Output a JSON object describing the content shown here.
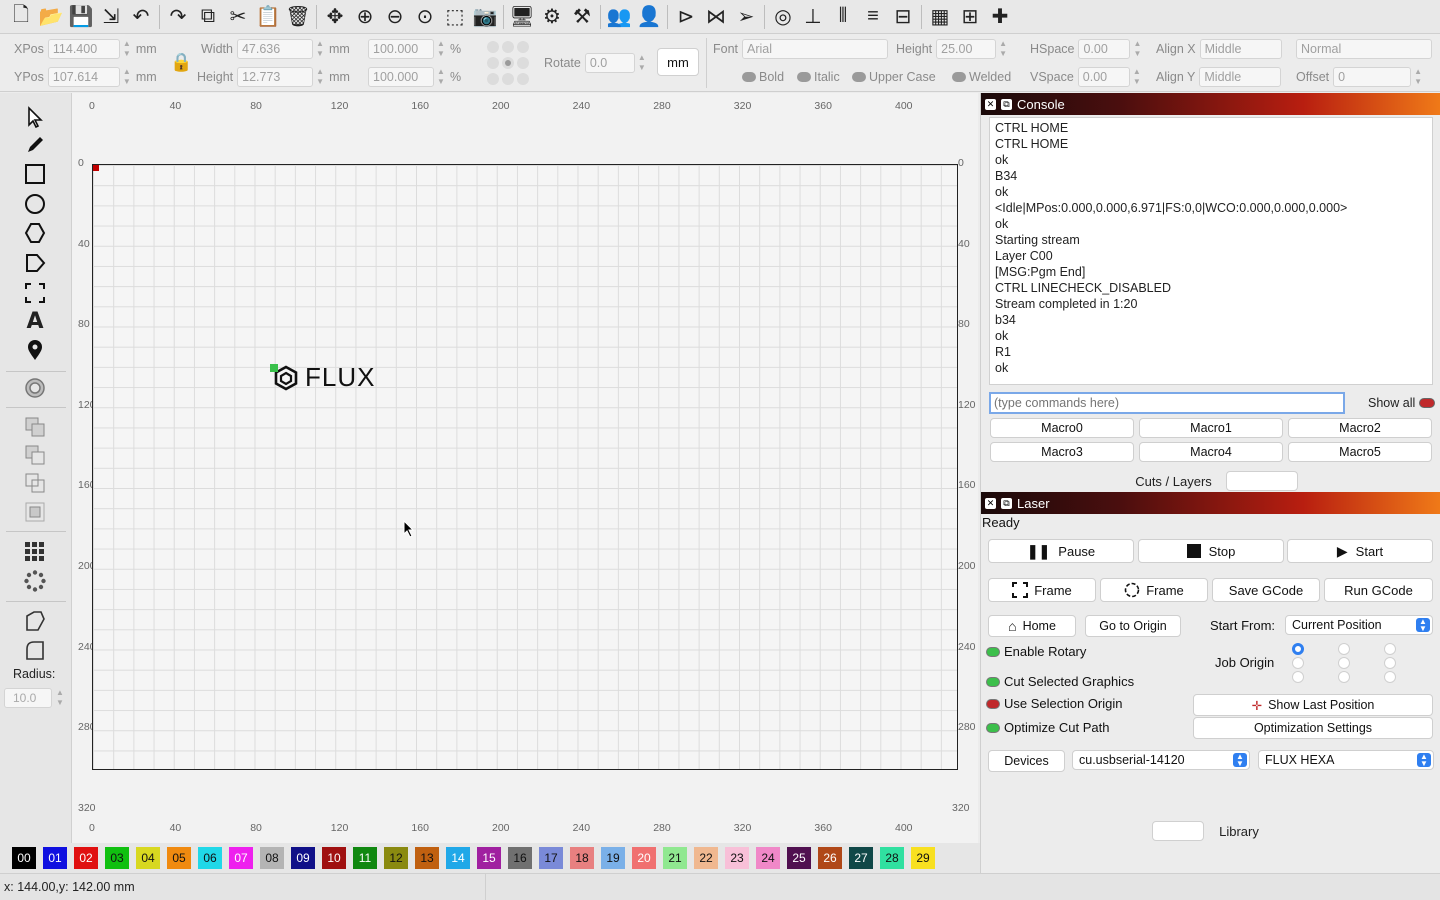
{
  "toolbar": {
    "icons": [
      "new-file-icon",
      "open-folder-icon",
      "save-icon",
      "export-icon",
      "undo-icon",
      "redo-icon",
      "copy-icon",
      "cut-icon",
      "paste-icon",
      "delete-icon",
      "move-icon",
      "zoom-in-icon",
      "zoom-out-icon",
      "zoom-fit-icon",
      "select-rect-icon",
      "camera-icon",
      "monitor-icon",
      "settings-gear-icon",
      "tools-icon",
      "group-icon",
      "ungroup-icon",
      "flip-horizontal-icon",
      "mirror-icon",
      "send-icon",
      "target-icon",
      "align-icon",
      "distribute-icon",
      "align-center-icon",
      "space-icon",
      "grid-icon",
      "ruler-icon",
      "snap-icon"
    ]
  },
  "properties": {
    "xpos_label": "XPos",
    "xpos_value": "114.400",
    "ypos_label": "YPos",
    "ypos_value": "107.614",
    "unit_mm": "mm",
    "width_label": "Width",
    "width_value": "47.636",
    "height_label": "Height",
    "height_value": "12.773",
    "scale_w": "100.000",
    "scale_h": "100.000",
    "percent": "%",
    "rotate_label": "Rotate",
    "rotate_value": "0.0",
    "unit_button": "mm",
    "font_label": "Font",
    "font_value": "Arial",
    "font_height_label": "Height",
    "font_height_value": "25.00",
    "hspace_label": "HSpace",
    "hspace_value": "0.00",
    "vspace_label": "VSpace",
    "vspace_value": "0.00",
    "align_x_label": "Align X",
    "align_x_value": "Middle",
    "align_y_label": "Align Y",
    "align_y_value": "Middle",
    "style_value": "Normal",
    "offset_label": "Offset",
    "offset_value": "0",
    "bold": "Bold",
    "italic": "Italic",
    "upper_case": "Upper Case",
    "welded": "Welded"
  },
  "left_tools": {
    "radius_label": "Radius:",
    "radius_value": "10.0"
  },
  "canvas": {
    "x_ticks": [
      "0",
      "40",
      "80",
      "120",
      "160",
      "200",
      "240",
      "280",
      "320",
      "360",
      "400"
    ],
    "y_ticks": [
      "0",
      "40",
      "80",
      "120",
      "160",
      "200",
      "240",
      "280",
      "320"
    ],
    "logo_text": "FLUX"
  },
  "palette": [
    {
      "label": "00",
      "color": "#000000",
      "text": "#ffffff"
    },
    {
      "label": "01",
      "color": "#1010e0",
      "text": "#ffffff"
    },
    {
      "label": "02",
      "color": "#e01010",
      "text": "#ffffff"
    },
    {
      "label": "03",
      "color": "#10c010",
      "text": "#111111"
    },
    {
      "label": "04",
      "color": "#d8d820",
      "text": "#111111"
    },
    {
      "label": "05",
      "color": "#f08a10",
      "text": "#111111"
    },
    {
      "label": "06",
      "color": "#20d8e8",
      "text": "#111111"
    },
    {
      "label": "07",
      "color": "#ee20ee",
      "text": "#ffffff"
    },
    {
      "label": "08",
      "color": "#b4b4b4",
      "text": "#111111"
    },
    {
      "label": "09",
      "color": "#101088",
      "text": "#ffffff"
    },
    {
      "label": "10",
      "color": "#a01010",
      "text": "#ffffff"
    },
    {
      "label": "11",
      "color": "#108810",
      "text": "#ffffff"
    },
    {
      "label": "12",
      "color": "#8a8a10",
      "text": "#111111"
    },
    {
      "label": "13",
      "color": "#c06010",
      "text": "#111111"
    },
    {
      "label": "14",
      "color": "#20a8e8",
      "text": "#ffffff"
    },
    {
      "label": "15",
      "color": "#a020a0",
      "text": "#ffffff"
    },
    {
      "label": "16",
      "color": "#707070",
      "text": "#111111"
    },
    {
      "label": "17",
      "color": "#7a8ad8",
      "text": "#111111"
    },
    {
      "label": "18",
      "color": "#e88080",
      "text": "#111111"
    },
    {
      "label": "19",
      "color": "#7ab0e8",
      "text": "#111111"
    },
    {
      "label": "20",
      "color": "#f07070",
      "text": "#ffffff"
    },
    {
      "label": "21",
      "color": "#90e890",
      "text": "#111111"
    },
    {
      "label": "22",
      "color": "#f0b890",
      "text": "#111111"
    },
    {
      "label": "23",
      "color": "#f8c0d8",
      "text": "#111111"
    },
    {
      "label": "24",
      "color": "#f088c8",
      "text": "#111111"
    },
    {
      "label": "25",
      "color": "#501050",
      "text": "#ffffff"
    },
    {
      "label": "26",
      "color": "#b04818",
      "text": "#ffffff"
    },
    {
      "label": "27",
      "color": "#104848",
      "text": "#ffffff"
    },
    {
      "label": "28",
      "color": "#30e0a0",
      "text": "#111111"
    },
    {
      "label": "29",
      "color": "#f8e020",
      "text": "#111111"
    }
  ],
  "status": {
    "coords": "x: 144.00,y: 142.00 mm"
  },
  "console": {
    "title": "Console",
    "lines": [
      "CTRL HOME",
      "CTRL HOME",
      "ok",
      "B34",
      "ok",
      "<Idle|MPos:0.000,0.000,6.971|FS:0,0|WCO:0.000,0.000,0.000>",
      "ok",
      "Starting stream",
      "Layer C00",
      "[MSG:Pgm End]",
      "CTRL LINECHECK_DISABLED",
      "Stream completed in 1:20",
      "b34",
      "ok",
      "R1",
      "ok"
    ],
    "input_placeholder": "(type commands here)",
    "show_all": "Show all",
    "macros": [
      "Macro0",
      "Macro1",
      "Macro2",
      "Macro3",
      "Macro4",
      "Macro5"
    ]
  },
  "tabs": {
    "cuts_layers": "Cuts / Layers",
    "library": "Library"
  },
  "laser": {
    "title": "Laser",
    "state": "Ready",
    "pause": "Pause",
    "stop": "Stop",
    "start": "Start",
    "frame1": "Frame",
    "frame2": "Frame",
    "save_gcode": "Save GCode",
    "run_gcode": "Run GCode",
    "home": "Home",
    "go_to_origin": "Go to Origin",
    "start_from_label": "Start From:",
    "start_from_value": "Current Position",
    "enable_rotary": "Enable Rotary",
    "job_origin": "Job Origin",
    "cut_selected": "Cut Selected Graphics",
    "use_selection_origin": "Use Selection Origin",
    "optimize_cut_path": "Optimize Cut Path",
    "show_last_position": "Show Last Position",
    "optimization_settings": "Optimization Settings",
    "devices": "Devices",
    "port": "cu.usbserial-14120",
    "machine": "FLUX HEXA"
  }
}
